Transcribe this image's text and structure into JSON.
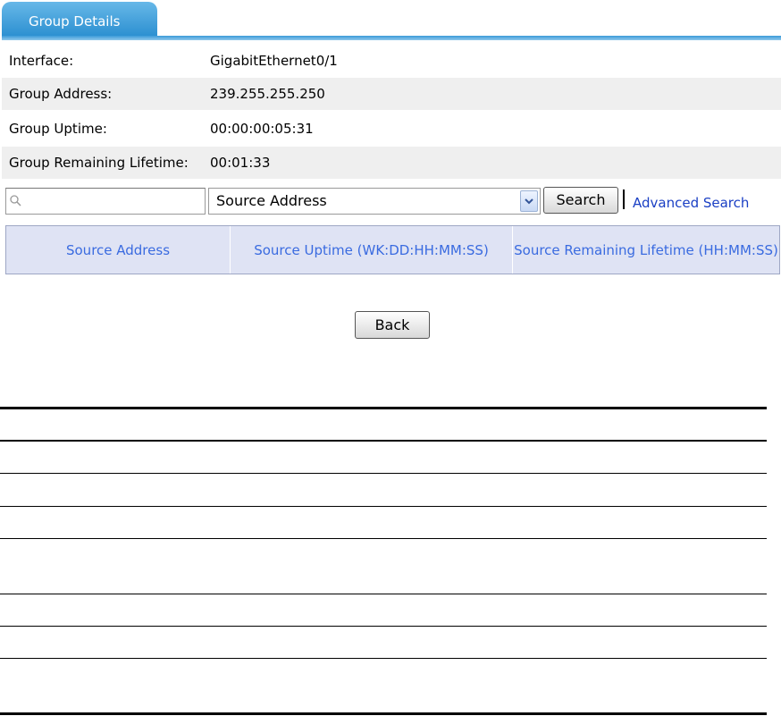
{
  "tab": {
    "label": "Group Details"
  },
  "details": [
    {
      "label": "Interface:",
      "value": "GigabitEthernet0/1"
    },
    {
      "label": "Group Address:",
      "value": "239.255.255.250"
    },
    {
      "label": "Group Uptime:",
      "value": "00:00:00:05:31"
    },
    {
      "label": "Group Remaining Lifetime:",
      "value": "00:01:33"
    }
  ],
  "search": {
    "query": "",
    "field": "Source Address",
    "button": "Search",
    "advanced": "Advanced Search"
  },
  "source_table": {
    "headers": [
      "Source Address",
      "Source Uptime (WK:DD:HH:MM:SS)",
      "Source Remaining Lifetime (HH:MM:SS)"
    ]
  },
  "back_button": "Back",
  "colors": {
    "tab": "#2a8ed0",
    "header_bg": "#dfe3f4",
    "header_text": "#3a6be0",
    "link": "#1a3fc4"
  }
}
